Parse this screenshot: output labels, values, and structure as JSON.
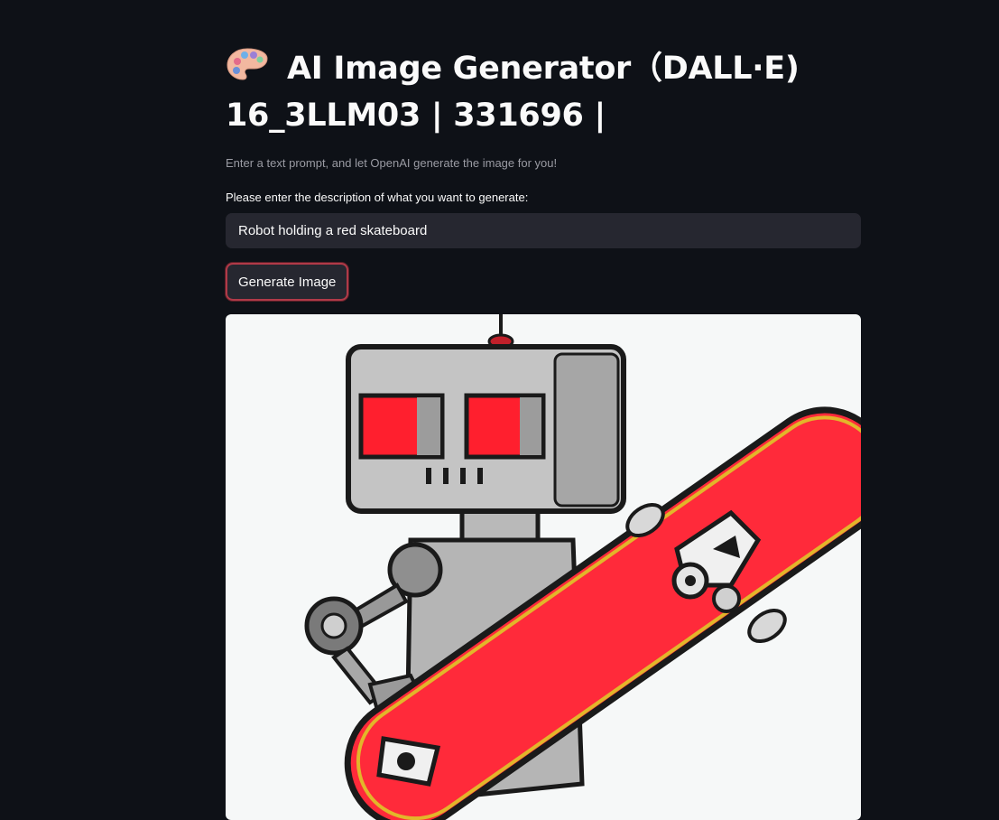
{
  "header": {
    "title_line1": "AI Image Generator（DALL·E)",
    "title_line2": "16_3LLM03 | 331696 |",
    "title_icon": "palette-icon"
  },
  "subtitle": "Enter a text prompt, and let OpenAI generate the image for you!",
  "prompt_field": {
    "label": "Please enter the description of what you want to generate:",
    "value": "Robot holding a red skateboard"
  },
  "generate_button": {
    "label": "Generate Image",
    "accent_color": "#b03a48"
  },
  "generated_image": {
    "subject": "Robot holding a red skateboard",
    "colors": {
      "skateboard": "#ff2a3a",
      "robot": "#bdbdbd",
      "eyes": "#ff2030",
      "background": "#f6f8f8"
    }
  },
  "colors": {
    "background": "#0e1117",
    "input_bg": "#262730",
    "text": "#fafafa",
    "muted_text": "#9a9ba3"
  }
}
